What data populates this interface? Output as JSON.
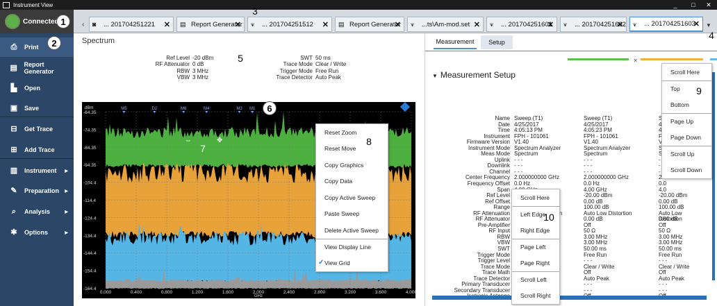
{
  "window": {
    "title": "Instrument View",
    "controls": [
      "_",
      "□",
      "✕"
    ]
  },
  "sidebar": {
    "connection": "Connected",
    "items": [
      {
        "label": "Print",
        "icon": "print-icon",
        "glyph": "⎙",
        "arrow": false
      },
      {
        "label": "Report Generator",
        "icon": "report-icon",
        "glyph": "▤",
        "arrow": false
      },
      {
        "label": "Open",
        "icon": "open-icon",
        "glyph": "▙",
        "arrow": false
      },
      {
        "label": "Save",
        "icon": "save-icon",
        "glyph": "▣",
        "arrow": false
      },
      {
        "label": "Get Trace",
        "icon": "get-trace-icon",
        "glyph": "⊟",
        "arrow": false
      },
      {
        "label": "Add Trace",
        "icon": "add-trace-icon",
        "glyph": "⊞",
        "arrow": false
      },
      {
        "label": "Instrument",
        "icon": "instrument-icon",
        "glyph": "▥",
        "arrow": true
      },
      {
        "label": "Preparation",
        "icon": "preparation-icon",
        "glyph": "✎",
        "arrow": true
      },
      {
        "label": "Analysis",
        "icon": "analysis-icon",
        "glyph": "⌕",
        "arrow": true
      },
      {
        "label": "Options",
        "icon": "options-icon",
        "glyph": "✱",
        "arrow": true
      }
    ]
  },
  "tabs": [
    {
      "label": "... 201704251221",
      "icon": "camera-icon",
      "glyph": "◙",
      "active": false
    },
    {
      "label": "Report Generator",
      "icon": "report-icon",
      "glyph": "▤",
      "active": false
    },
    {
      "label": "... 201704251512",
      "icon": "trace-icon",
      "glyph": "⩛",
      "active": false
    },
    {
      "label": "Report Generator",
      "icon": "report-icon",
      "glyph": "▤",
      "active": false
    },
    {
      "label": "...ts\\Am-mod.set",
      "icon": "trace-icon",
      "glyph": "⩛",
      "active": false
    },
    {
      "label": "... 201704251601",
      "icon": "trace-icon",
      "glyph": "⩛",
      "active": false
    },
    {
      "label": "... 201704251602",
      "icon": "trace-icon",
      "glyph": "⩛",
      "active": false
    },
    {
      "label": "... 201704251603",
      "icon": "trace-icon",
      "glyph": "⩛",
      "active": true
    }
  ],
  "spectrum": {
    "title": "Spectrum",
    "left_params": [
      {
        "k": "Ref Level",
        "v": "-20 dBm"
      },
      {
        "k": "RF Attenuator",
        "v": "0 dB"
      },
      {
        "k": "RBW",
        "v": "3 MHz"
      },
      {
        "k": "VBW",
        "v": "3 MHz"
      }
    ],
    "right_params": [
      {
        "k": "SWT",
        "v": "50 ms"
      },
      {
        "k": "Trace Mode",
        "v": "Clear / Write"
      },
      {
        "k": "Trigger Mode",
        "v": "Free Run"
      },
      {
        "k": "Trace Detector",
        "v": "Auto Peak"
      }
    ]
  },
  "chart_data": {
    "type": "area",
    "ylabel": "dBm",
    "xlabel": "GHz",
    "ylim": [
      -164.4,
      -64.35
    ],
    "y_ticks": [
      "-64.35",
      "-74.35",
      "-84.35",
      "-94.35",
      "-104.4",
      "-114.4",
      "-124.4",
      "-134.4",
      "-144.4",
      "-154.4",
      "-164.4"
    ],
    "y_values": [
      -64.35,
      -74.35,
      -84.35,
      -94.35,
      -104.4,
      -114.4,
      -124.4,
      -134.4,
      -144.4,
      -154.4,
      -164.4
    ],
    "x_ticks": [
      "0.000",
      "0.400",
      "0.800",
      "1.200",
      "1.600",
      "2.000",
      "2.400",
      "2.800",
      "3.200",
      "3.600",
      "4.000"
    ],
    "x_values": [
      0.0,
      0.4,
      0.8,
      1.2,
      1.6,
      2.0,
      2.4,
      2.8,
      3.2,
      3.6,
      4.0
    ],
    "markers": [
      {
        "label": "M5",
        "x": 0.24
      },
      {
        "label": "D2",
        "x": 0.64
      },
      {
        "label": "M6",
        "x": 1.02
      },
      {
        "label": "M4",
        "x": 1.32
      },
      {
        "label": "M3",
        "x": 1.75
      },
      {
        "label": "M1",
        "x": 1.92
      }
    ],
    "series": [
      {
        "color": "#4caf3f",
        "top": -76,
        "bottom": -94,
        "peak": -64.35
      },
      {
        "color": "#e8a23a",
        "top": -99,
        "bottom": -132,
        "peak": -94.35
      },
      {
        "color": "#55b6e6",
        "top": -136,
        "bottom": -160,
        "peak": -128
      },
      {
        "color": "#9a9a9a",
        "top": -160,
        "bottom": -164.4,
        "peak": -150
      }
    ],
    "grid": true
  },
  "spectrum_menu": {
    "items": [
      "Reset Zoom",
      "Reset Move",
      "Copy Graphics",
      "Copy Data",
      "Copy Active Sweep",
      "Paste Sweep",
      "Delete Active Sweep",
      "View Display Line",
      "View Grid"
    ],
    "checked": "View Grid"
  },
  "right_panel": {
    "tabs": [
      "Measurement",
      "Setup"
    ],
    "section": "Measurement Setup",
    "color_bars": [
      "#5cbf4f",
      "#f0b040",
      "#6ab9e8"
    ],
    "rows": [
      {
        "k": "Name",
        "c1": "Sweep (T1)",
        "c2": "Sweep (T1)",
        "c3": "Swe"
      },
      {
        "k": "Date",
        "c1": "4/25/2017",
        "c2": "4/25/2017",
        "c3": "4/25"
      },
      {
        "k": "Time",
        "c1": "4:05:13 PM",
        "c2": "4:05:23 PM",
        "c3": "4:05"
      },
      {
        "k": "Instrument",
        "c1": "FPH - 101061",
        "c2": "FPH - 101061",
        "c3": "FPH"
      },
      {
        "k": "Firmware Version",
        "c1": "V1.40",
        "c2": "V1.40",
        "c3": "V1."
      },
      {
        "k": "Instrument Mode",
        "c1": "Spectrum Analyzer",
        "c2": "Spectrum Analyzer",
        "c3": "Spe"
      },
      {
        "k": "Meas Mode",
        "c1": "Spectrum",
        "c2": "Spectrum",
        "c3": "Spe"
      },
      {
        "k": "Uplink",
        "c1": "- - -",
        "c2": "- - -",
        "c3": "- -"
      },
      {
        "k": "Downlink",
        "c1": "- - -",
        "c2": "- - -",
        "c3": "- -"
      },
      {
        "k": "Channel",
        "c1": "- - -",
        "c2": "- - -",
        "c3": "- - -"
      },
      {
        "k": "Center Frequency",
        "c1": "2.000000000 GHz",
        "c2": "2.000000000 GHz",
        "c3": "2.0"
      },
      {
        "k": "Frequency Offset",
        "c1": "0.0 Hz",
        "c2": "0.0 Hz",
        "c3": "0.0"
      },
      {
        "k": "Span",
        "c1": "4.00 GHz",
        "c2": "4.00 GHz",
        "c3": "4.0"
      },
      {
        "k": "Ref Level",
        "c1": "-20.00 dBm",
        "c2": "-20.00 dBm",
        "c3": "-20.00 dBm"
      },
      {
        "k": "Ref Offset",
        "c1": "0.00 dB",
        "c2": "0.00 dB",
        "c3": "0.00 dB"
      },
      {
        "k": "Range",
        "c1": "",
        "c2": "100.00 dB",
        "c3": "100.00 dB"
      },
      {
        "k": "RF Attenuation",
        "c1": "Auto Low Distortion",
        "c2": "Auto Low Distortion",
        "c3": "Auto Low Distortion"
      },
      {
        "k": "RF Attenuator",
        "c1": "",
        "c2": "0.00 dB",
        "c3": "0.00 dB"
      },
      {
        "k": "Pre-Amplifier",
        "c1": "",
        "c2": "Off",
        "c3": "Off"
      },
      {
        "k": "RF Input",
        "c1": "",
        "c2": "50 Ω",
        "c3": "50 Ω"
      },
      {
        "k": "RBW",
        "c1": "",
        "c2": "3.00 MHz",
        "c3": "3.00 MHz"
      },
      {
        "k": "VBW",
        "c1": "",
        "c2": "3.00 MHz",
        "c3": "3.00 MHz"
      },
      {
        "k": "SWT",
        "c1": "",
        "c2": "50.00 ms",
        "c3": "50.00 ms"
      },
      {
        "k": "Trigger Mode",
        "c1": "",
        "c2": "Free Run",
        "c3": "Free Run"
      },
      {
        "k": "Trigger Level",
        "c1": "",
        "c2": "- - -",
        "c3": "- - -"
      },
      {
        "k": "Trace Mode",
        "c1": "",
        "c2": "Clear / Write",
        "c3": "Clear / Write"
      },
      {
        "k": "Trace Math",
        "c1": "",
        "c2": "Off",
        "c3": "Off"
      },
      {
        "k": "Trace Detector",
        "c1": "",
        "c2": "Auto Peak",
        "c3": "Auto Peak"
      },
      {
        "k": "Primary Transducer",
        "c1": "",
        "c2": "- - -",
        "c3": "- - -"
      },
      {
        "k": "Secondary Transducer",
        "c1": "",
        "c2": "- - -",
        "c3": "- - -"
      },
      {
        "k": "Isotropic Antenna",
        "c1": "",
        "c2": "Off",
        "c3": "Off"
      }
    ]
  },
  "vscroll_menu": {
    "items": [
      "Scroll Here",
      "Top",
      "Bottom",
      "Page Up",
      "Page Down",
      "Scroll Up",
      "Scroll Down"
    ]
  },
  "hscroll_menu": {
    "items": [
      "Scroll Here",
      "Left Edge",
      "Right Edge",
      "Page Left",
      "Page Right",
      "Scroll Left",
      "Scroll Right"
    ]
  },
  "callouts": [
    "1",
    "2",
    "3",
    "4",
    "5",
    "6",
    "7",
    "8",
    "9",
    "10"
  ]
}
